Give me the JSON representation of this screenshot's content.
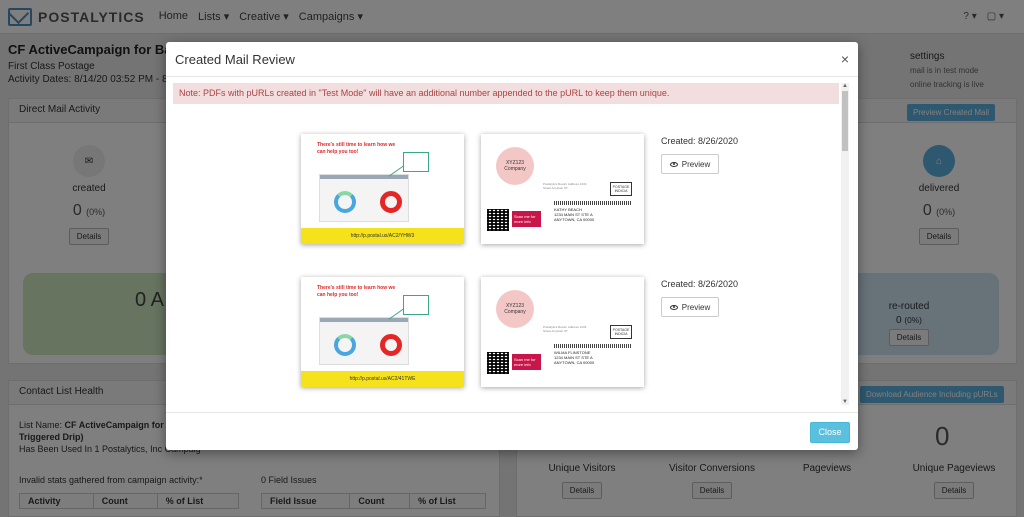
{
  "nav": {
    "brand": "POSTALYTICS",
    "links": [
      "Home",
      "Lists ▾",
      "Creative ▾",
      "Campaigns ▾"
    ],
    "help": "? ▾",
    "user": "▢ ▾"
  },
  "campaign": {
    "title": "CF ActiveCampaign for Batch T",
    "postage": "First Class Postage",
    "dates": "Activity Dates: 8/14/20 03:52 PM - 8/26/2"
  },
  "settings": {
    "label": "settings",
    "test_mode": "mail is in test mode",
    "tracking": "online tracking is live"
  },
  "direct_mail": {
    "header": "Direct Mail Activity",
    "preview_btn": "Preview Created Mail",
    "created_label": "created",
    "created_value": "0",
    "created_pct": "(0%)",
    "delivered_label": "delivered",
    "delivered_value": "0",
    "delivered_pct": "(0%)",
    "details": "Details",
    "big_value": "0 A",
    "rerouted_label": "re-routed",
    "rerouted_value": "0",
    "rerouted_pct": "(0%)"
  },
  "contact": {
    "header": "Contact List Health",
    "list_name_label": "List Name:",
    "list_name": "CF ActiveCampaign for Ba",
    "list_name_cont": "Triggered Drip)",
    "used_in": "Has Been Used In 1 Postalytics, Inc Campaig",
    "invalid_stats": "Invalid stats gathered from campaign activity:*",
    "field_issues": "0 Field Issues",
    "col_activity": "Activity",
    "col_count": "Count",
    "col_pct": "% of List",
    "col_field_issue": "Field Issue",
    "col_count2": "Count",
    "col_pct2": "% of List"
  },
  "web": {
    "download_btn": "Download Audience Including pURLs",
    "big_zero": "0",
    "unique_visitors": "Unique Visitors",
    "visitor_conversions": "Visitor Conversions",
    "pageviews": "Pageviews",
    "unique_pageviews": "Unique Pageviews",
    "details": "Details"
  },
  "modal": {
    "title": "Created Mail Review",
    "close_x": "×",
    "note": "Note: PDFs with pURLs created in \"Test Mode\" will have an additional number appended to the pURL to keep them unique.",
    "close_button": "Close",
    "rows": [
      {
        "created": "Created: 8/26/2020",
        "preview": "Preview",
        "headline": "There's still time to learn how we can help you too!",
        "purl": "http://p.postal.us/AC2/YHW3",
        "company": "XYZ123 Company",
        "stamp": "POSTAGE INDICIA",
        "return_addr": "Postalytics Return Address 1234 Street Anytown ST",
        "addr_name": "KATHY BEACH",
        "addr_line1": "1234 MAIN ST STE A",
        "addr_line2": "ANYTOWN, CA 00000",
        "scan": "Scan me for more info"
      },
      {
        "created": "Created: 8/26/2020",
        "preview": "Preview",
        "headline": "There's still time to learn how we can help you too!",
        "purl": "http://p.postal.us/AC2/41TWE",
        "company": "XYZ123 Company",
        "stamp": "POSTAGE INDICIA",
        "return_addr": "Postalytics Return Address 1234 Street Anytown ST",
        "addr_name": "WILMA FLINSTONE",
        "addr_line1": "1234 MAIN ST STE A",
        "addr_line2": "ANYTOWN, CA 00000",
        "scan": "Scan me for more info"
      }
    ]
  }
}
